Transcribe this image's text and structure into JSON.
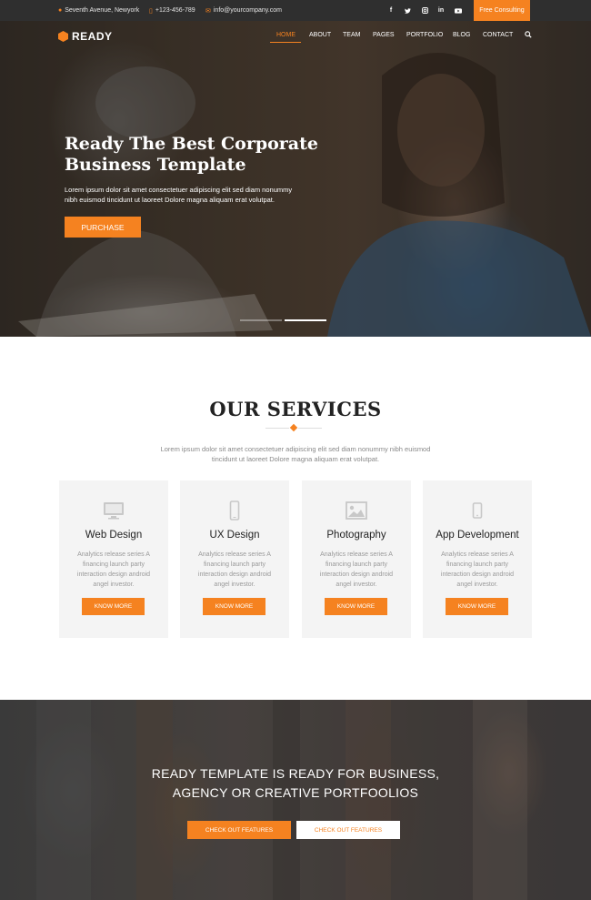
{
  "topbar": {
    "address": "Seventh Avenue, Newyork",
    "phone": "+123-456-789",
    "email": "info@yourcompany.com",
    "social": [
      "f",
      "t",
      "ig",
      "in",
      "yt"
    ],
    "consult_label": "Free Consulting",
    "address_icon": "map-pin-icon",
    "phone_icon": "phone-icon",
    "email_icon": "envelope-icon"
  },
  "brand": {
    "name": "READY",
    "logo_icon": "hexagon-icon"
  },
  "nav": {
    "items": [
      "HOME",
      "ABOUT",
      "TEAM",
      "PAGES",
      "PORTFOLIO",
      "BLOG",
      "CONTACT"
    ],
    "active": "HOME",
    "search_icon": "search-icon"
  },
  "hero": {
    "title": "Ready The Best Corporate Business Template",
    "text": "Lorem ipsum dolor sit amet consectetuer adipiscing elit sed diam nonummy nibh euismod tincidunt ut laoreet Dolore magna aliquam erat volutpat.",
    "button": "PURCHASE",
    "slides": 2,
    "active_slide": 2
  },
  "services": {
    "title": "OUR SERVICES",
    "subtitle": "Lorem ipsum dolor sit amet consectetuer adipiscing elit sed diam nonummy nibh euismod tincidunt ut laoreet Dolore magna aliquam erat volutpat.",
    "cards": [
      {
        "title": "Web Design",
        "desc": "Analytics release series A financing launch party interaction design android angel investor.",
        "button": "KNOW MORE",
        "icon": "monitor-icon"
      },
      {
        "title": "UX Design",
        "desc": "Analytics release series A financing launch party interaction design android angel investor.",
        "button": "KNOW MORE",
        "icon": "mobile-icon"
      },
      {
        "title": "Photography",
        "desc": "Analytics release series A financing launch party interaction design android angel investor.",
        "button": "KNOW MORE",
        "icon": "image-icon"
      },
      {
        "title": "App Development",
        "desc": "Analytics release series A financing launch party interaction design android angel investor.",
        "button": "KNOW MORE",
        "icon": "smartphone-icon"
      }
    ]
  },
  "cta": {
    "line1": "READY TEMPLATE IS READY FOR BUSINESS,",
    "line2": "AGENCY OR CREATIVE PORTFOOLIOS",
    "button1": "CHECK OUT FEATURES",
    "button2": "CHECK OUT FEATURES"
  },
  "colors": {
    "accent": "#f58220",
    "topbar": "#2f2f2f",
    "card": "#f4f4f4"
  }
}
